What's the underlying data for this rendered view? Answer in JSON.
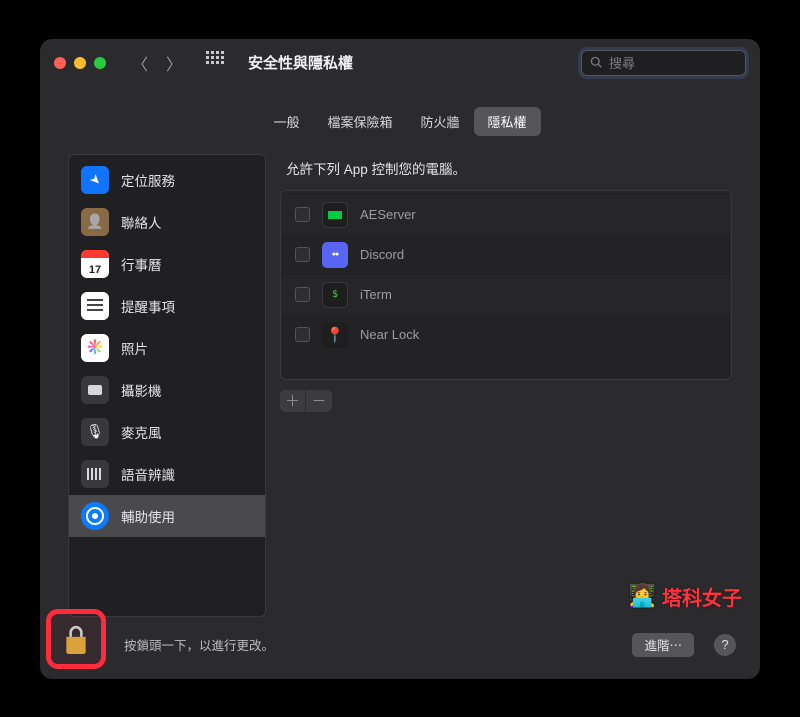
{
  "window": {
    "title": "安全性與隱私權"
  },
  "search": {
    "placeholder": "搜尋"
  },
  "tabs": [
    {
      "label": "一般",
      "active": false
    },
    {
      "label": "檔案保險箱",
      "active": false
    },
    {
      "label": "防火牆",
      "active": false
    },
    {
      "label": "隱私權",
      "active": true
    }
  ],
  "sidebar": {
    "items": [
      {
        "label": "定位服務",
        "icon": "location",
        "selected": false
      },
      {
        "label": "聯絡人",
        "icon": "contacts",
        "selected": false
      },
      {
        "label": "行事曆",
        "icon": "calendar",
        "selected": false
      },
      {
        "label": "提醒事項",
        "icon": "reminders",
        "selected": false
      },
      {
        "label": "照片",
        "icon": "photos",
        "selected": false
      },
      {
        "label": "攝影機",
        "icon": "camera",
        "selected": false
      },
      {
        "label": "麥克風",
        "icon": "microphone",
        "selected": false
      },
      {
        "label": "語音辨識",
        "icon": "speech",
        "selected": false
      },
      {
        "label": "輔助使用",
        "icon": "accessibility",
        "selected": true
      }
    ]
  },
  "right": {
    "description": "允許下列 App 控制您的電腦。",
    "apps": [
      {
        "name": "AEServer",
        "icon": "aes",
        "checked": false
      },
      {
        "name": "Discord",
        "icon": "discord",
        "checked": false
      },
      {
        "name": "iTerm",
        "icon": "iterm",
        "checked": false
      },
      {
        "name": "Near Lock",
        "icon": "near",
        "checked": false
      }
    ]
  },
  "footer": {
    "lock_text": "按鎖頭一下，以進行更改。",
    "advanced": "進階⋯",
    "help": "?"
  },
  "watermark": {
    "text": "塔科女子"
  }
}
